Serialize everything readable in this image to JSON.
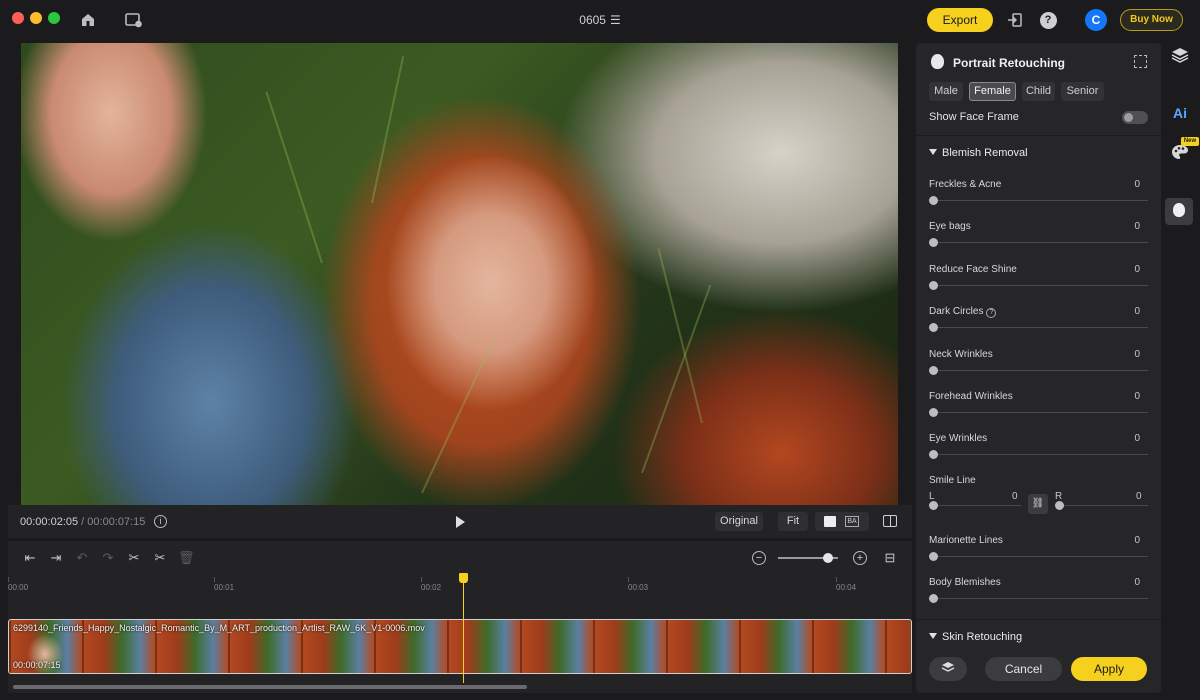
{
  "titlebar": {
    "project": "0605",
    "export_label": "Export",
    "buy_label": "Buy Now",
    "avatar_letter": "C",
    "help_glyph": "?"
  },
  "playback": {
    "current_time": "00:00:02:05",
    "separator": " / ",
    "total_time": "00:00:07:15",
    "original_label": "Original",
    "fit_label": "Fit"
  },
  "timeline": {
    "ticks": [
      "00:00",
      "00:01",
      "00:02",
      "00:03",
      "00:04"
    ],
    "clip_name": "6299140_Friends_Happy_Nostalgic_Romantic_By_M_ART_production_Artlist_RAW_6K_V1-0006.mov",
    "clip_duration": "00:00:07:15"
  },
  "panel": {
    "title": "Portrait Retouching",
    "gender_tabs": [
      {
        "label": "Male",
        "active": false
      },
      {
        "label": "Female",
        "active": true
      },
      {
        "label": "Child",
        "active": false
      },
      {
        "label": "Senior",
        "active": false
      }
    ],
    "show_face_frame": "Show Face Frame",
    "blemish_section": "Blemish Removal",
    "sliders": [
      {
        "label": "Freckles & Acne",
        "value": "0"
      },
      {
        "label": "Eye bags",
        "value": "0"
      },
      {
        "label": "Reduce Face Shine",
        "value": "0"
      },
      {
        "label": "Dark Circles",
        "value": "0"
      },
      {
        "label": "Neck Wrinkles",
        "value": "0"
      },
      {
        "label": "Forehead Wrinkles",
        "value": "0"
      },
      {
        "label": "Eye Wrinkles",
        "value": "0"
      }
    ],
    "smile": {
      "label": "Smile Line",
      "left_label": "L",
      "left_value": "0",
      "right_label": "R",
      "right_value": "0"
    },
    "sliders_bottom": [
      {
        "label": "Marionette Lines",
        "value": "0"
      },
      {
        "label": "Body Blemishes",
        "value": "0"
      }
    ],
    "skin_section": "Skin Retouching",
    "cancel_label": "Cancel",
    "apply_label": "Apply"
  },
  "rail": {
    "ai_label": "Ai",
    "new_badge": "New"
  },
  "colors": {
    "accent": "#f5d01c",
    "avatar": "#1477f8",
    "ai": "#5aa8ff"
  }
}
